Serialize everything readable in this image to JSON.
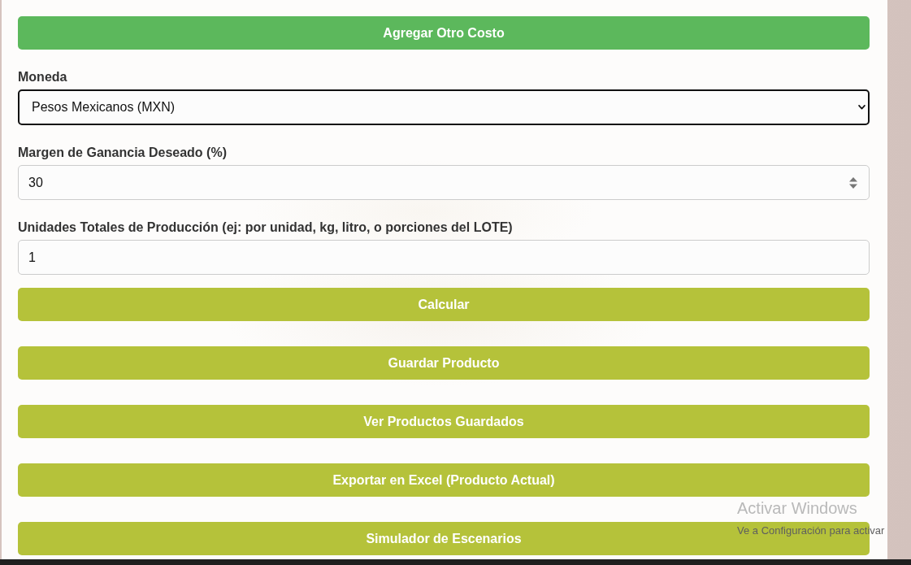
{
  "add_cost_button": {
    "label": "Agregar Otro Costo"
  },
  "fields": [
    {
      "kind": "select",
      "label": "Moneda",
      "value": "Pesos Mexicanos (MXN)",
      "focused": true
    },
    {
      "kind": "number",
      "label": "Margen de Ganancia Deseado (%)",
      "value": "30",
      "focused": false
    },
    {
      "kind": "text",
      "label": "Unidades Totales de Producción (ej: por unidad, kg, litro, o porciones del LOTE)",
      "value": "1",
      "focused": false
    }
  ],
  "action_buttons": [
    {
      "label": "Calcular"
    },
    {
      "label": "Guardar Producto"
    },
    {
      "label": "Ver Productos Guardados"
    },
    {
      "label": "Exportar en Excel (Producto Actual)"
    },
    {
      "label": "Simulador de Escenarios"
    }
  ],
  "os_overlay": {
    "title": "Activar Windows",
    "note": "Ve a Configuración para activar"
  }
}
